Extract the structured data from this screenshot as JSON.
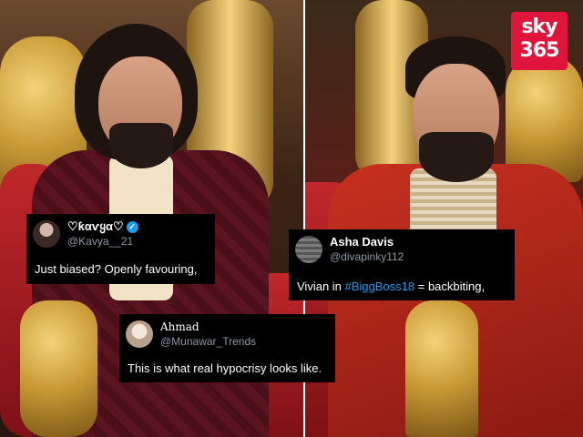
{
  "logo": {
    "line1": "sky",
    "line2": "365"
  },
  "tweets": [
    {
      "name": "♡ƙαѵყα♡",
      "verified": true,
      "handle": "@Kavya__21",
      "text": "Just biased? Openly favouring,"
    },
    {
      "name": "Asha Davis",
      "verified": false,
      "handle": "@divapinky112",
      "text_before": "Vivian  in ",
      "hashtag": "#BiggBoss18",
      "text_after": " = backbiting,"
    },
    {
      "name": "Ahmad",
      "verified": false,
      "handle": "@Munawar_Trends",
      "text": "This is what real hypocrisy looks like."
    }
  ],
  "colors": {
    "logo_bg": "#e0153b",
    "hashtag": "#1d9bf0",
    "handle": "#8b98a5",
    "card_bg": "#000000"
  }
}
